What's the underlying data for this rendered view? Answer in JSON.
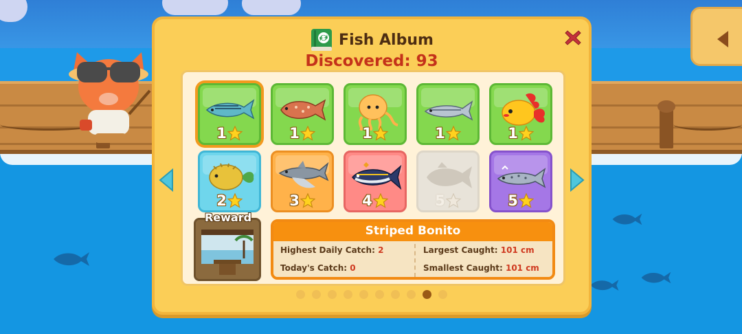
{
  "album": {
    "title": "Fish Album",
    "discovered": "Discovered: 93",
    "reward_label": "Reward"
  },
  "fish": [
    {
      "name": "mackerel",
      "stars": "1",
      "tier": "green",
      "selected": true
    },
    {
      "name": "rockfish",
      "stars": "1",
      "tier": "green"
    },
    {
      "name": "jellyfish",
      "stars": "1",
      "tier": "green"
    },
    {
      "name": "sardine",
      "stars": "1",
      "tier": "green"
    },
    {
      "name": "goldfish",
      "stars": "1",
      "tier": "green"
    },
    {
      "name": "pufferfish",
      "stars": "2",
      "tier": "cyan"
    },
    {
      "name": "shark",
      "stars": "3",
      "tier": "orange"
    },
    {
      "name": "tuna",
      "stars": "4",
      "tier": "red"
    },
    {
      "name": "undiscovered-fish",
      "stars": "5",
      "tier": "grey"
    },
    {
      "name": "trout",
      "stars": "5",
      "tier": "purple"
    }
  ],
  "details": {
    "fish_name": "Striped Bonito",
    "highest_daily_catch_label": "Highest Daily Catch:",
    "highest_daily_catch_value": "2",
    "todays_catch_label": "Today's Catch:",
    "todays_catch_value": "0",
    "largest_caught_label": "Largest Caught:",
    "largest_caught_value": "101 cm",
    "smallest_caught_label": "Smallest Caught:",
    "smallest_caught_value": "101 cm"
  },
  "pagination": {
    "total_pages": 10,
    "current_page": 9
  },
  "colors": {
    "panel": "#fbce57",
    "accent": "#f7900f",
    "title": "#4d2d12",
    "counter": "#c4321a"
  }
}
